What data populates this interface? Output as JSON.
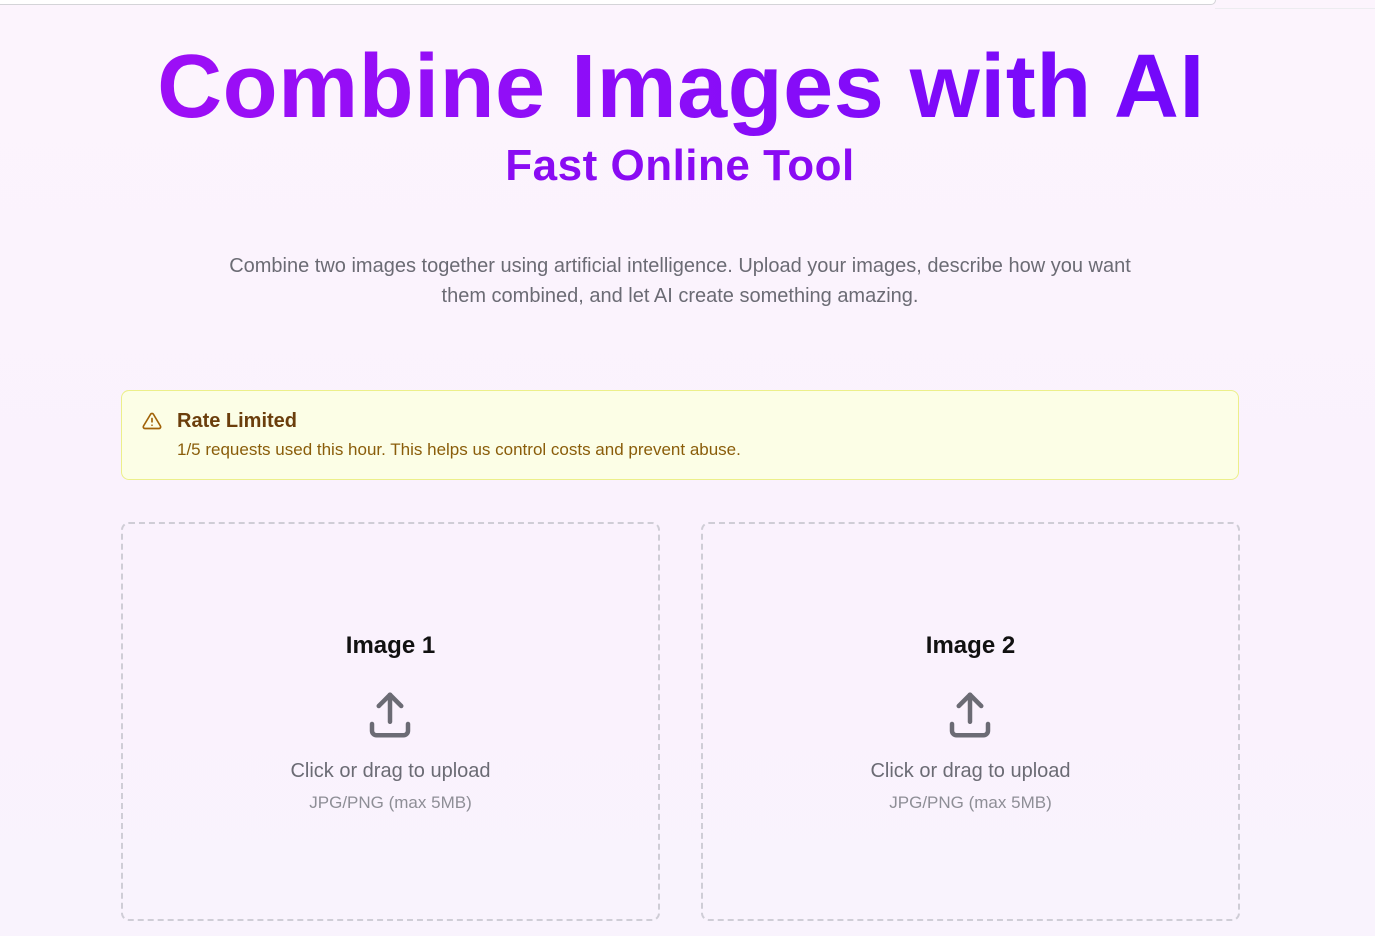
{
  "hero": {
    "title": "Combine Images with AI",
    "subtitle": "Fast Online Tool",
    "description": "Combine two images together using artificial intelligence. Upload your images, describe how you want them combined, and let AI create something amazing."
  },
  "alert": {
    "icon": "warning-triangle-icon",
    "title": "Rate Limited",
    "message": "1/5 requests used this hour. This helps us control costs and prevent abuse."
  },
  "uploads": [
    {
      "label": "Image 1",
      "icon": "upload-icon",
      "prompt": "Click or drag to upload",
      "hint": "JPG/PNG (max 5MB)"
    },
    {
      "label": "Image 2",
      "icon": "upload-icon",
      "prompt": "Click or drag to upload",
      "hint": "JPG/PNG (max 5MB)"
    }
  ],
  "colors": {
    "title_gradient_start": "#a20ff5",
    "title_gradient_end": "#6a06fb",
    "subtitle": "#8a0bf3",
    "alert_background": "#fcfee6",
    "alert_border": "#ecef8a",
    "alert_title": "#6b3e0c",
    "alert_text": "#8a5d0a"
  }
}
